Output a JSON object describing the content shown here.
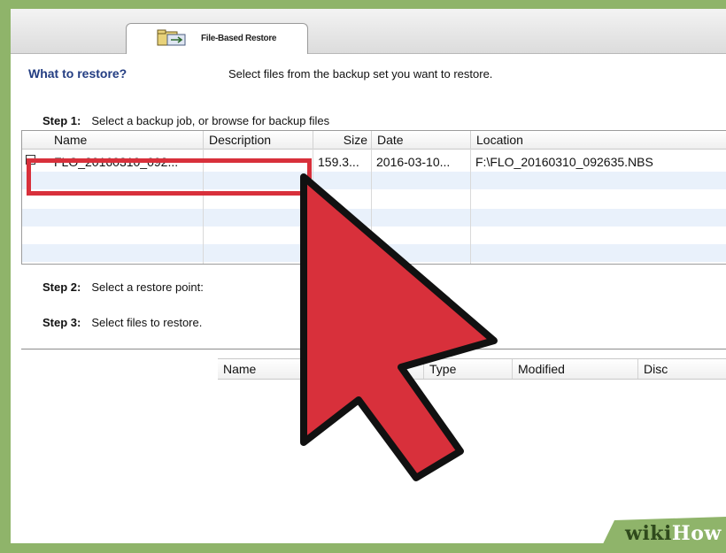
{
  "tab": {
    "label": "File-Based Restore"
  },
  "main": {
    "heading": "What to restore?",
    "instruction": "Select files from the backup set you want to restore."
  },
  "steps": [
    {
      "number": "Step 1:",
      "text": "Select a backup job, or browse for backup files"
    },
    {
      "number": "Step 2:",
      "text": "Select a restore point:"
    },
    {
      "number": "Step 3:",
      "text": "Select files to restore."
    }
  ],
  "backup_table": {
    "columns": [
      "Name",
      "Description",
      "Size",
      "Date",
      "Location"
    ],
    "rows": [
      {
        "name": "FLO_20160310_092...",
        "description": "",
        "size": "159.3...",
        "date": "2016-03-10...",
        "location": "F:\\FLO_20160310_092635.NBS"
      }
    ]
  },
  "file_list": {
    "columns": [
      "Name",
      "Type",
      "Modified",
      "Disc"
    ]
  },
  "annotation": {
    "highlight_color": "#d8303b",
    "arrow_color": "#d8303b"
  },
  "watermark": {
    "wiki": "wiki",
    "how": "How"
  }
}
